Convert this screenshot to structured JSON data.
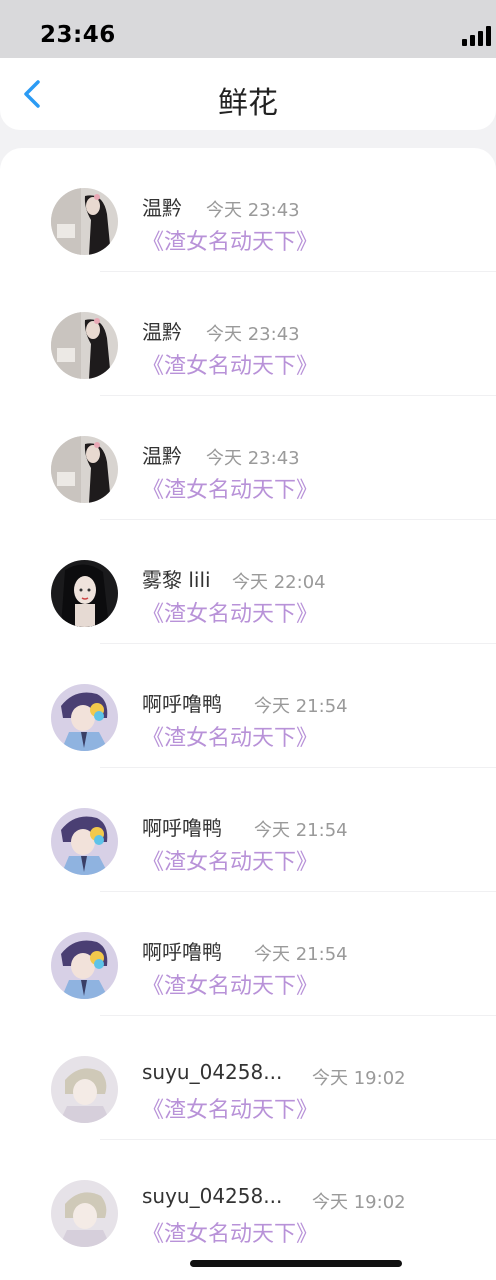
{
  "status_bar": {
    "time": "23:46"
  },
  "header": {
    "title": "鲜花",
    "back_icon": "chevron-left-icon",
    "accent_color": "#2b9bf4"
  },
  "colors": {
    "novel_link": "#b892d8",
    "timestamp": "#9a9a9a"
  },
  "flowers": [
    {
      "user": "温黔",
      "time": "今天 23:43",
      "novel": "《渣女名动天下》",
      "avatar": "girl-dark-hair"
    },
    {
      "user": "温黔",
      "time": "今天 23:43",
      "novel": "《渣女名动天下》",
      "avatar": "girl-dark-hair"
    },
    {
      "user": "温黔",
      "time": "今天 23:43",
      "novel": "《渣女名动天下》",
      "avatar": "girl-dark-hair"
    },
    {
      "user": "雾黎 lili",
      "time": "今天 22:04",
      "novel": "《渣女名动天下》",
      "avatar": "anime-girl-black"
    },
    {
      "user": "啊呼噜鸭",
      "time": "今天 21:54",
      "novel": "《渣女名动天下》",
      "avatar": "anime-boy-purple"
    },
    {
      "user": "啊呼噜鸭",
      "time": "今天 21:54",
      "novel": "《渣女名动天下》",
      "avatar": "anime-boy-purple"
    },
    {
      "user": "啊呼噜鸭",
      "time": "今天 21:54",
      "novel": "《渣女名动天下》",
      "avatar": "anime-boy-purple"
    },
    {
      "user": "suyu_04258...",
      "time": "今天 19:02",
      "novel": "《渣女名动天下》",
      "avatar": "anime-pale"
    },
    {
      "user": "suyu_04258...",
      "time": "今天 19:02",
      "novel": "《渣女名动天下》",
      "avatar": "anime-pale"
    }
  ]
}
